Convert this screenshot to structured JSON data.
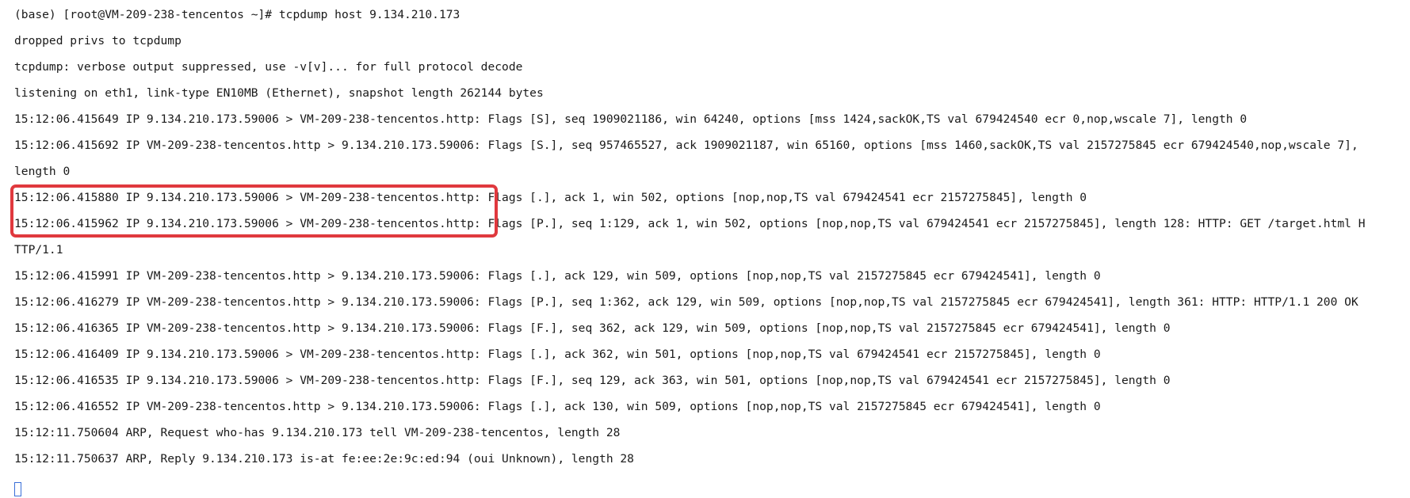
{
  "terminal": {
    "lines": [
      "(base) [root@VM-209-238-tencentos ~]# tcpdump host 9.134.210.173",
      "dropped privs to tcpdump",
      "tcpdump: verbose output suppressed, use -v[v]... for full protocol decode",
      "listening on eth1, link-type EN10MB (Ethernet), snapshot length 262144 bytes",
      "15:12:06.415649 IP 9.134.210.173.59006 > VM-209-238-tencentos.http: Flags [S], seq 1909021186, win 64240, options [mss 1424,sackOK,TS val 679424540 ecr 0,nop,wscale 7], length 0",
      "15:12:06.415692 IP VM-209-238-tencentos.http > 9.134.210.173.59006: Flags [S.], seq 957465527, ack 1909021187, win 65160, options [mss 1460,sackOK,TS val 2157275845 ecr 679424540,nop,wscale 7],",
      "length 0",
      "15:12:06.415880 IP 9.134.210.173.59006 > VM-209-238-tencentos.http: Flags [.], ack 1, win 502, options [nop,nop,TS val 679424541 ecr 2157275845], length 0",
      "15:12:06.415962 IP 9.134.210.173.59006 > VM-209-238-tencentos.http: Flags [P.], seq 1:129, ack 1, win 502, options [nop,nop,TS val 679424541 ecr 2157275845], length 128: HTTP: GET /target.html H",
      "TTP/1.1",
      "15:12:06.415991 IP VM-209-238-tencentos.http > 9.134.210.173.59006: Flags [.], ack 129, win 509, options [nop,nop,TS val 2157275845 ecr 679424541], length 0",
      "15:12:06.416279 IP VM-209-238-tencentos.http > 9.134.210.173.59006: Flags [P.], seq 1:362, ack 129, win 509, options [nop,nop,TS val 2157275845 ecr 679424541], length 361: HTTP: HTTP/1.1 200 OK",
      "15:12:06.416365 IP VM-209-238-tencentos.http > 9.134.210.173.59006: Flags [F.], seq 362, ack 129, win 509, options [nop,nop,TS val 2157275845 ecr 679424541], length 0",
      "15:12:06.416409 IP 9.134.210.173.59006 > VM-209-238-tencentos.http: Flags [.], ack 362, win 501, options [nop,nop,TS val 679424541 ecr 2157275845], length 0",
      "15:12:06.416535 IP 9.134.210.173.59006 > VM-209-238-tencentos.http: Flags [F.], seq 129, ack 363, win 501, options [nop,nop,TS val 679424541 ecr 2157275845], length 0",
      "15:12:06.416552 IP VM-209-238-tencentos.http > 9.134.210.173.59006: Flags [.], ack 130, win 509, options [nop,nop,TS val 2157275845 ecr 679424541], length 0",
      "15:12:11.750604 ARP, Request who-has 9.134.210.173 tell VM-209-238-tencentos, length 28",
      "15:12:11.750637 ARP, Reply 9.134.210.173 is-at fe:ee:2e:9c:ed:94 (oui Unknown), length 28"
    ]
  },
  "colors": {
    "background": "#ffffff",
    "text": "#1a1a1a",
    "highlight_border": "#e0393e",
    "cursor": "#3a6fd8"
  }
}
